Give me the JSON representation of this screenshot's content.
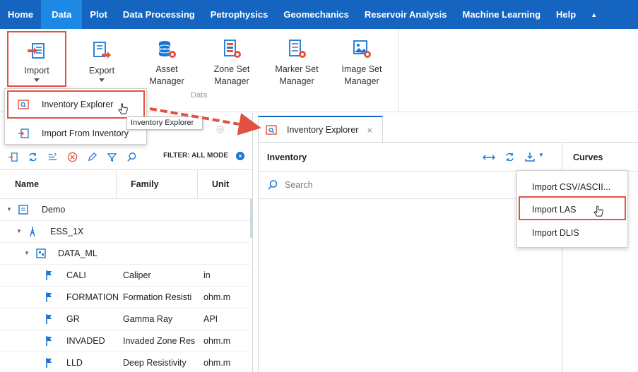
{
  "menubar": {
    "items": [
      "Home",
      "Data",
      "Plot",
      "Data Processing",
      "Petrophysics",
      "Geomechanics",
      "Reservoir Analysis",
      "Machine Learning",
      "Help"
    ],
    "active": "Data",
    "colors": {
      "bar": "#1565c0",
      "active": "#1e88e5"
    }
  },
  "ribbon": {
    "import_label": "Import",
    "export_label": "Export",
    "asset_manager_label_1": "Asset",
    "asset_manager_label_2": "Manager",
    "zone_set_label_1": "Zone Set",
    "zone_set_label_2": "Manager",
    "marker_set_label_1": "Marker Set",
    "marker_set_label_2": "Manager",
    "image_set_label_1": "Image Set",
    "image_set_label_2": "Manager",
    "group_label": "Data"
  },
  "import_menu": {
    "items": [
      "Inventory Explorer",
      "Import From Inventory"
    ],
    "tooltip": "Inventory Explorer"
  },
  "left_panel": {
    "filter_label": "FILTER: ALL MODE",
    "columns": [
      "Name",
      "Family",
      "Unit"
    ],
    "rows": [
      {
        "name": "Demo",
        "family": "",
        "unit": ""
      },
      {
        "name": "ESS_1X",
        "family": "",
        "unit": ""
      },
      {
        "name": "DATA_ML",
        "family": "",
        "unit": ""
      },
      {
        "name": "CALI",
        "family": "Caliper",
        "unit": "in"
      },
      {
        "name": "FORMATION",
        "family": "Formation Resisti",
        "unit": "ohm.m"
      },
      {
        "name": "GR",
        "family": "Gamma Ray",
        "unit": "API"
      },
      {
        "name": "INVADED",
        "family": "Invaded Zone Res",
        "unit": "ohm.m"
      },
      {
        "name": "LLD",
        "family": "Deep Resistivity",
        "unit": "ohm.m"
      }
    ]
  },
  "right": {
    "tab_label": "Inventory Explorer",
    "inventory_title": "Inventory",
    "search_placeholder": "Search",
    "curves_title": "Curves",
    "import_options": [
      "Import CSV/ASCII...",
      "Import LAS",
      "Import DLIS"
    ],
    "highlighted_option": "Import LAS"
  },
  "accent": {
    "highlight": "#e25241",
    "icon_blue": "#1976d2",
    "icon_red": "#e25241"
  }
}
